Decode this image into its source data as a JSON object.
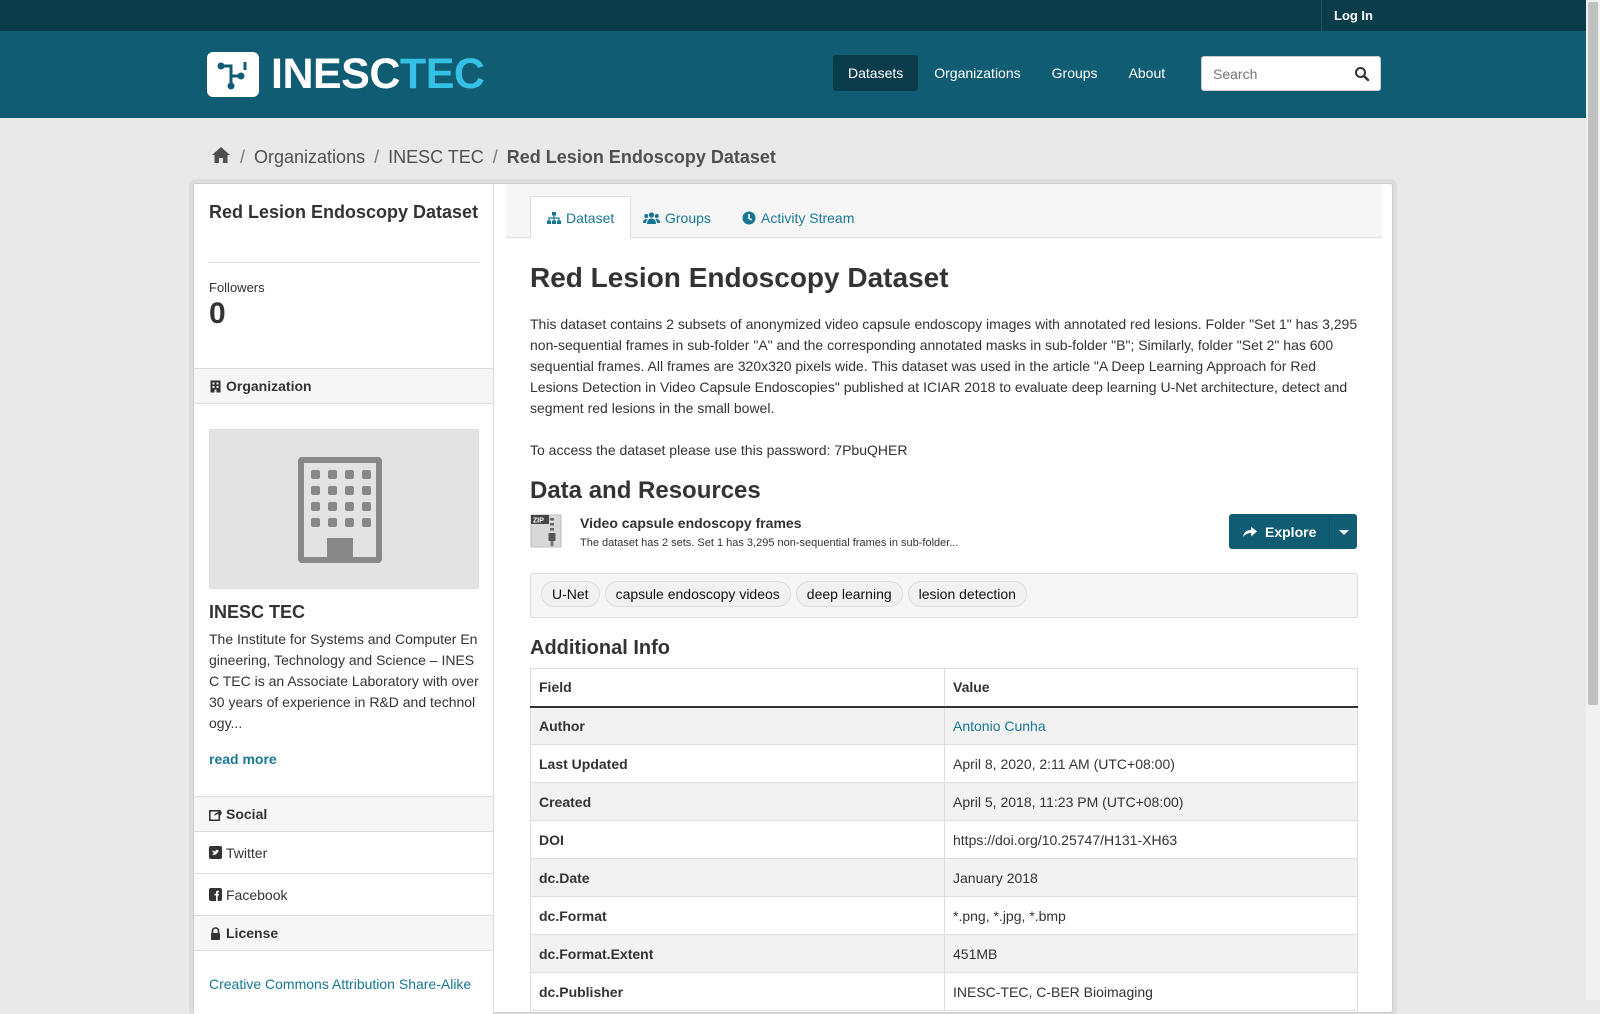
{
  "account": {
    "login_label": "Log In"
  },
  "header": {
    "logo_part1": "INESC",
    "logo_part2": "TEC",
    "nav": [
      {
        "label": "Datasets",
        "active": true
      },
      {
        "label": "Organizations"
      },
      {
        "label": "Groups"
      },
      {
        "label": "About"
      }
    ],
    "search_placeholder": "Search"
  },
  "breadcrumb": {
    "home_icon": "home-icon",
    "items": [
      "Organizations",
      "INESC TEC"
    ],
    "current": "Red Lesion Endoscopy Dataset"
  },
  "sidebar": {
    "title": "Red Lesion Endoscopy Dataset",
    "followers_label": "Followers",
    "followers_count": "0",
    "organization_heading": "Organization",
    "org_name": "INESC TEC",
    "org_description": "The Institute for Systems and Computer Engineering, Technology and Science – INESC TEC is an Associate Laboratory with over 30 years of experience in R&D and technology...",
    "read_more": "read more",
    "social_heading": "Social",
    "twitter": "Twitter",
    "facebook": "Facebook",
    "license_heading": "License",
    "license_link": "Creative Commons Attribution Share-Alike"
  },
  "tabs": [
    {
      "label": "Dataset",
      "icon": "sitemap-icon",
      "active": true
    },
    {
      "label": "Groups",
      "icon": "users-icon"
    },
    {
      "label": "Activity Stream",
      "icon": "clock-icon"
    }
  ],
  "main": {
    "title": "Red Lesion Endoscopy Dataset",
    "description": "This dataset contains 2 subsets of anonymized video capsule endoscopy images with annotated red lesions. Folder \"Set 1\" has 3,295 non-sequential frames in sub-folder \"A\" and the corresponding annotated masks in sub-folder \"B\"; Similarly, folder \"Set 2\" has 600 sequential frames. All frames are 320x320 pixels wide. This dataset was used in the article \"A Deep Learning Approach for Red Lesions Detection in Video Capsule Endoscopies\" published at ICIAR 2018 to evaluate deep learning U-Net architecture, detect and segment red lesions in the small bowel.",
    "password_text": "To access the dataset please use this password: 7PbuQHER",
    "resources_title": "Data and Resources",
    "resource": {
      "format_label": "ZIP",
      "title": "Video capsule endoscopy frames",
      "description": "The dataset has 2 sets. Set 1 has 3,295 non-sequential frames in sub-folder...",
      "explore_label": "Explore"
    },
    "tags": [
      "U-Net",
      "capsule endoscopy videos",
      "deep learning",
      "lesion detection"
    ],
    "additional_info_title": "Additional Info",
    "table": {
      "headers": [
        "Field",
        "Value"
      ],
      "rows": [
        {
          "field": "Author",
          "value": "Antonio Cunha",
          "link": true
        },
        {
          "field": "Last Updated",
          "value": "April 8, 2020, 2:11 AM (UTC+08:00)"
        },
        {
          "field": "Created",
          "value": "April 5, 2018, 11:23 PM (UTC+08:00)"
        },
        {
          "field": "DOI",
          "value": "https://doi.org/10.25747/H131-XH63"
        },
        {
          "field": "dc.Date",
          "value": "January 2018"
        },
        {
          "field": "dc.Format",
          "value": "*.png, *.jpg, *.bmp"
        },
        {
          "field": "dc.Format.Extent",
          "value": "451MB"
        },
        {
          "field": "dc.Publisher",
          "value": "INESC-TEC, C-BER Bioimaging"
        }
      ]
    }
  },
  "colors": {
    "masthead": "#105d73",
    "account_bar": "#0b3c4c",
    "link": "#187794",
    "logo_accent": "#35c0e5"
  }
}
